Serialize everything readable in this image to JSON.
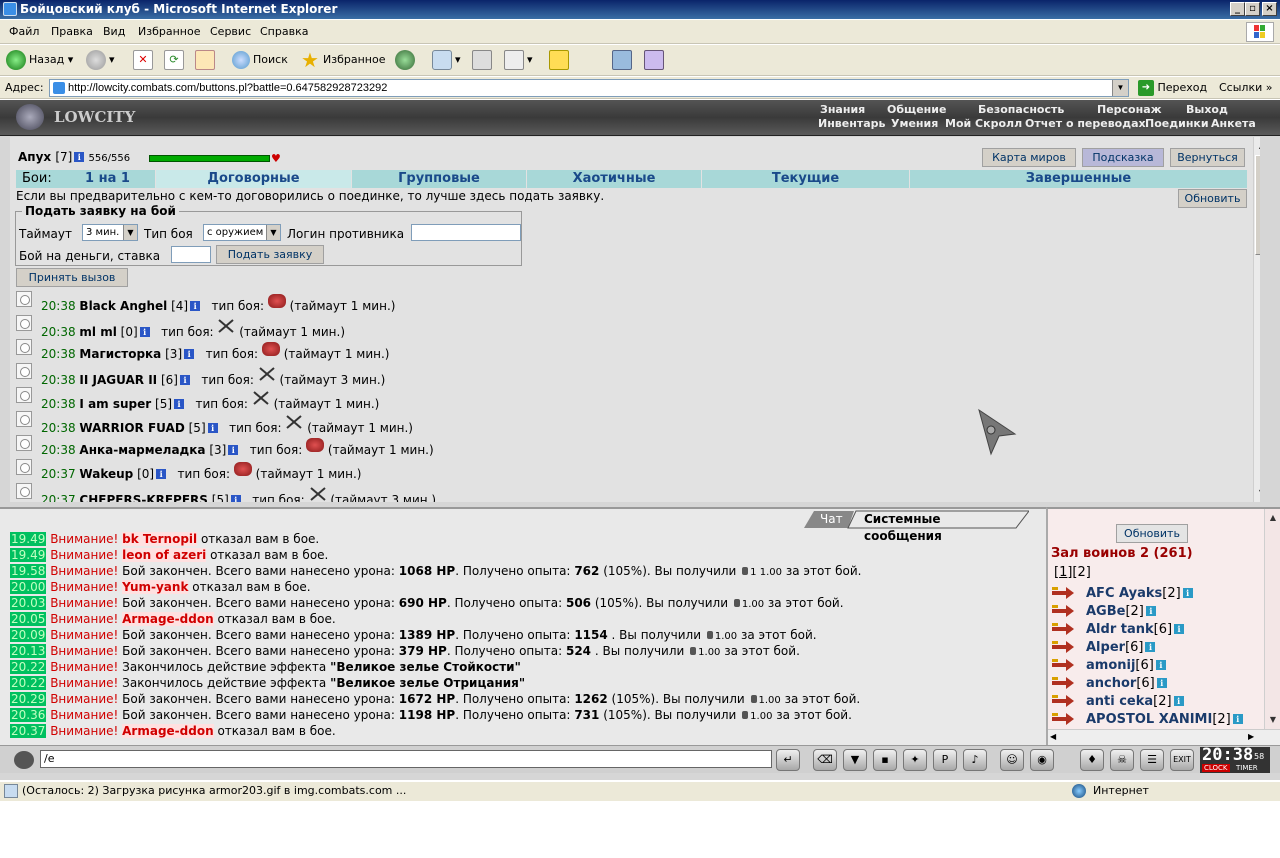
{
  "window": {
    "title": "Бойцовский клуб - Microsoft Internet Explorer",
    "controls": [
      "_",
      "▫",
      "×"
    ]
  },
  "menu": [
    "Файл",
    "Правка",
    "Вид",
    "Избранное",
    "Сервис",
    "Справка"
  ],
  "toolbar": {
    "back": "Назад",
    "search": "Поиск",
    "favorites": "Избранное"
  },
  "address": {
    "label": "Адрес:",
    "url": "http://lowcity.combats.com/buttons.pl?battle=0.647582928723292",
    "go": "Переход",
    "links": "Ссылки"
  },
  "site": {
    "logo": "LOWCITY",
    "topnav": [
      "Знания",
      "Общение",
      "Безопасность",
      "Персонаж",
      "Выход"
    ],
    "subnav": [
      "Инвентарь",
      "Умения",
      "Мой Скролл",
      "Отчет о переводах",
      "Поединки",
      "Анкета"
    ]
  },
  "player": {
    "name": "Апух",
    "level": "[7]",
    "hp": "556/556"
  },
  "top_buttons": {
    "map": "Карта миров",
    "hint": "Подсказка",
    "back": "Вернуться",
    "refresh": "Обновить"
  },
  "battle_tabs": {
    "label": "Бои:",
    "items": [
      "1 на 1",
      "Договорные",
      "Групповые",
      "Хаотичные",
      "Текущие",
      "Завершенные"
    ]
  },
  "intro": "Если вы предварительно с кем-то договорились о поединке, то лучше здесь подать заявку.",
  "form": {
    "legend": "Подать заявку на бой",
    "timeout_label": "Таймаут",
    "timeout_value": "3 мин.",
    "type_label": "Тип боя",
    "type_value": "с оружием",
    "opponent_label": "Логин противника",
    "money_label": "Бой на деньги, ставка",
    "submit": "Подать заявку"
  },
  "accept_button": "Принять вызов",
  "requests": [
    {
      "time": "20:38",
      "nick": "Black Anghel",
      "level": "[4]",
      "type_label": "тип боя:",
      "icon": "fist-icon",
      "timeout": "(таймаут 1 мин.)"
    },
    {
      "time": "20:38",
      "nick": "ml ml",
      "level": "[0]",
      "type_label": "тип боя:",
      "icon": "swords-icon",
      "timeout": "(таймаут 1 мин.)"
    },
    {
      "time": "20:38",
      "nick": "Магисторка",
      "level": "[3]",
      "type_label": "тип боя:",
      "icon": "fist-icon",
      "timeout": "(таймаут 1 мин.)"
    },
    {
      "time": "20:38",
      "nick": "II JAGUAR II",
      "level": "[6]",
      "type_label": "тип боя:",
      "icon": "swords-icon",
      "timeout": "(таймаут 3 мин.)"
    },
    {
      "time": "20:38",
      "nick": "I am super",
      "level": "[5]",
      "type_label": "тип боя:",
      "icon": "swords-icon",
      "timeout": "(таймаут 1 мин.)"
    },
    {
      "time": "20:38",
      "nick": "WARRIOR FUAD",
      "level": "[5]",
      "type_label": "тип боя:",
      "icon": "swords-icon",
      "timeout": "(таймаут 1 мин.)"
    },
    {
      "time": "20:38",
      "nick": "Анка-мармеладка",
      "level": "[3]",
      "type_label": "тип боя:",
      "icon": "fist-icon",
      "timeout": "(таймаут 1 мин.)"
    },
    {
      "time": "20:37",
      "nick": "Wakeup",
      "level": "[0]",
      "type_label": "тип боя:",
      "icon": "fist-icon",
      "timeout": "(таймаут 1 мин.)"
    },
    {
      "time": "20:37",
      "nick": "CHEPERS-KREPERS",
      "level": "[5]",
      "type_label": "тип боя:",
      "icon": "swords-icon",
      "timeout": "(таймаут 3 мин.)"
    }
  ],
  "chat": {
    "tabs": [
      "Чат",
      "Системные сообщения"
    ],
    "attention": "Внимание!",
    "lines": [
      {
        "time": "19.49",
        "kind": "refuse",
        "who": "bk Ternopil",
        "text": "отказал вам в бое."
      },
      {
        "time": "19.49",
        "kind": "refuse",
        "who": "leon of azeri",
        "text": "отказал вам в бое."
      },
      {
        "time": "19.58",
        "kind": "end",
        "p1": "Бой закончен. Всего вами нанесено урона:",
        "dmg": "1068 HP",
        "p2": ". Получено опыта:",
        "exp": "762",
        "p3": "(105%). Вы получили",
        "coins": "1  1.00",
        "p4": "за этот бой."
      },
      {
        "time": "20.00",
        "kind": "refuse",
        "who": "Yum-yank",
        "text": "отказал вам в бое."
      },
      {
        "time": "20.03",
        "kind": "end",
        "p1": "Бой закончен. Всего вами нанесено урона:",
        "dmg": "690 HP",
        "p2": ". Получено опыта:",
        "exp": "506",
        "p3": "(105%). Вы получили",
        "coins": "1.00",
        "p4": "за этот бой."
      },
      {
        "time": "20.05",
        "kind": "refuse",
        "who": "Armage-ddon",
        "text": "отказал вам в бое."
      },
      {
        "time": "20.09",
        "kind": "end",
        "p1": "Бой закончен. Всего вами нанесено урона:",
        "dmg": "1389 HP",
        "p2": ". Получено опыта:",
        "exp": "1154",
        "p3": ". Вы получили",
        "coins": "1.00",
        "p4": "за этот бой."
      },
      {
        "time": "20.13",
        "kind": "end",
        "p1": "Бой закончен. Всего вами нанесено урона:",
        "dmg": "379 HP",
        "p2": ". Получено опыта:",
        "exp": "524",
        "p3": ". Вы получили",
        "coins": "1.00",
        "p4": "за этот бой."
      },
      {
        "time": "20.22",
        "kind": "effect",
        "p1": "Закончилось действие эффекта",
        "effect": "\"Великое зелье Стойкости\""
      },
      {
        "time": "20.22",
        "kind": "effect",
        "p1": "Закончилось действие эффекта",
        "effect": "\"Великое зелье Отрицания\""
      },
      {
        "time": "20.29",
        "kind": "end",
        "p1": "Бой закончен. Всего вами нанесено урона:",
        "dmg": "1672 HP",
        "p2": ". Получено опыта:",
        "exp": "1262",
        "p3": "(105%). Вы получили",
        "coins": "1.00",
        "p4": "за этот бой."
      },
      {
        "time": "20.36",
        "kind": "end",
        "p1": "Бой закончен. Всего вами нанесено урона:",
        "dmg": "1198 HP",
        "p2": ". Получено опыта:",
        "exp": "731",
        "p3": "(105%). Вы получили",
        "coins": "1.00",
        "p4": "за этот бой."
      },
      {
        "time": "20.37",
        "kind": "refuse",
        "who": "Armage-ddon",
        "text": "отказал вам в бое."
      }
    ]
  },
  "users": {
    "refresh": "Обновить",
    "hall": "Зал воинов 2 (261)",
    "pages": [
      "1",
      "2"
    ],
    "list": [
      {
        "name": "AFC Ayaks",
        "level": "[2]"
      },
      {
        "name": "AGBe",
        "level": "[2]"
      },
      {
        "name": "Aldr tank",
        "level": "[6]"
      },
      {
        "name": "Alper",
        "level": "[6]"
      },
      {
        "name": "amonij",
        "level": "[6]"
      },
      {
        "name": "anchor",
        "level": "[6]"
      },
      {
        "name": "anti ceka",
        "level": "[2]"
      },
      {
        "name": "APOSTOL XANIMI",
        "level": "[2]"
      }
    ]
  },
  "bottom": {
    "chat_input": "/e",
    "clock": "20:38",
    "seconds": "58",
    "clock_label1": "CLOCK",
    "clock_label2": "TIMER"
  },
  "status": {
    "text": "(Осталось: 2) Загрузка рисунка armor203.gif в img.combats.com ...",
    "zone": "Интернет"
  },
  "colors": {
    "tab_bg": "#a8d8d8",
    "time_green": "#006600",
    "warn_red": "#d00000",
    "hp_green": "#00aa00"
  }
}
